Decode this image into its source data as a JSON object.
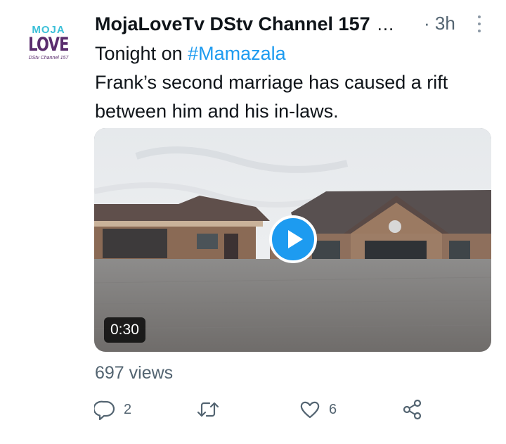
{
  "account": {
    "avatar_line1": "MOJA",
    "avatar_line2": "LOVE",
    "avatar_line3": "DStv Channel 157",
    "display_name": "MojaLoveTv DStv Channel 157",
    "truncation": "...",
    "time": "· 3h"
  },
  "tweet": {
    "line1_prefix": "Tonight on ",
    "hashtag": "#Mamazala",
    "line2": "Frank’s second marriage has caused a rift between him and his in-laws."
  },
  "media": {
    "type": "video",
    "duration": "0:30",
    "views": "697 views"
  },
  "actions": {
    "reply_icon": "reply-icon",
    "reply_count": "2",
    "retweet_icon": "retweet-icon",
    "like_icon": "like-icon",
    "like_count": "6",
    "share_icon": "share-icon"
  },
  "colors": {
    "accent": "#1d9bf0",
    "text": "#0f1419",
    "secondary": "#536471",
    "avatar_teal": "#3cc0d8",
    "avatar_purple": "#5a2d6e"
  }
}
